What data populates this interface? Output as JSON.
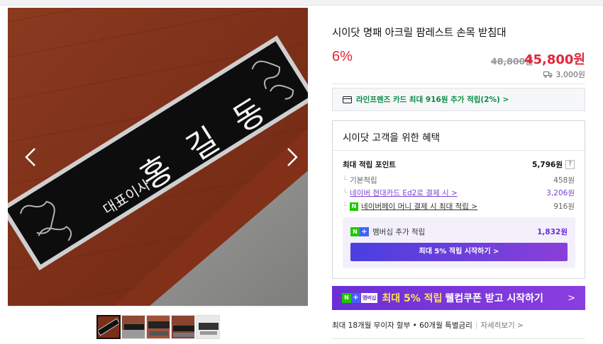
{
  "product": {
    "title": "시이닷 명패 아크릴 팜레스트 손목 받침대",
    "discount": "6%",
    "original_price": "48,800원",
    "sale_price": "45,800원",
    "shipping": "3,000원"
  },
  "gallery": {
    "plate_text_left": "대표이사",
    "plate_text_main": "홍 길 동",
    "prev_icon": "chevron-left-icon",
    "next_icon": "chevron-right-icon",
    "thumbnail_count": 5,
    "active_thumbnail": 1
  },
  "card_banner": {
    "label": "라인프렌즈 카드 최대 916원 추가 적립(2%) >",
    "icon": "credit-card-icon"
  },
  "benefits": {
    "heading": "시이닷 고객을 위한 혜택",
    "max_points_label": "최대 적립 포인트",
    "max_points_value": "5,796원",
    "help": "?",
    "items": [
      {
        "label": "기본적립",
        "value": "458원"
      },
      {
        "label": "네이버 현대카드 Ed2로 결제 시 >",
        "value": "3,206원"
      },
      {
        "label": "네이버페이 머니 결제 시 최대 적립 >",
        "value": "916원"
      }
    ],
    "membership": {
      "label": "멤버십 추가 적립",
      "value": "1,832원",
      "button": "최대 5% 적립 시작하기 >"
    }
  },
  "promo": {
    "badge_n": "N",
    "badge_plus": "+",
    "badge_text": "멤버십",
    "highlight": "최대 5% 적립",
    "text": "웰컴쿠폰 받고 시작하기",
    "arrow": ">"
  },
  "installment": {
    "text": "최대 18개월 무이자 할부 • 60개월 특별금리",
    "more": "자세히보기 >"
  },
  "colors": {
    "discount_red": "#e0263b",
    "card_green": "#0a8a46",
    "purple": "#7a43d1",
    "promo_purple": "#6b2fd6",
    "naver_green": "#1ec800"
  }
}
